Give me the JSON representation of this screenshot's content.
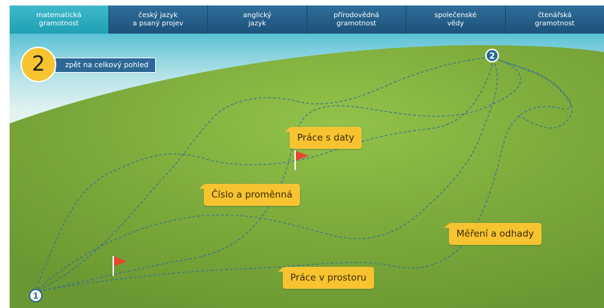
{
  "tabs": [
    {
      "line1": "matematická",
      "line2": "gramotnost",
      "active": true
    },
    {
      "line1": "český jazyk",
      "line2": "a psaný projev",
      "active": false
    },
    {
      "line1": "anglický",
      "line2": "jazyk",
      "active": false
    },
    {
      "line1": "přírodovědná",
      "line2": "gramotnost",
      "active": false
    },
    {
      "line1": "společenské",
      "line2": "vědy",
      "active": false
    },
    {
      "line1": "čtenářská",
      "line2": "gramotnost",
      "active": false
    }
  ],
  "level": {
    "number": "2"
  },
  "back_button": {
    "label": "zpět na celkový pohled"
  },
  "map": {
    "start_marker": "1",
    "end_marker": "2",
    "topics": [
      {
        "label": "Práce s daty"
      },
      {
        "label": "Číslo a proměnná"
      },
      {
        "label": "Měření a odhady"
      },
      {
        "label": "Práce v prostoru"
      }
    ]
  },
  "colors": {
    "tab_bg": "#1d5179",
    "tab_active_bg": "#1fa0b4",
    "grass": "#7aa83a",
    "path": "#2d6e99",
    "bubble": "#f8c331",
    "flag": "#e8452c",
    "marker": "#2b6896"
  }
}
